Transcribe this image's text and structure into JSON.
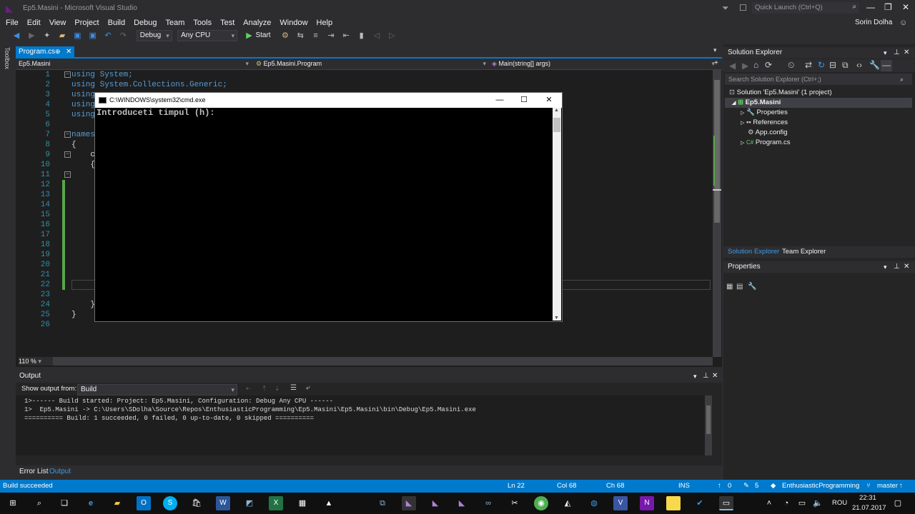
{
  "window": {
    "title": "Ep5.Masini - Microsoft Visual Studio",
    "quick_launch": "Quick Launch (Ctrl+Q)",
    "user": "Sorin Dolha"
  },
  "menu": [
    "File",
    "Edit",
    "View",
    "Project",
    "Build",
    "Debug",
    "Team",
    "Tools",
    "Test",
    "Analyze",
    "Window",
    "Help"
  ],
  "toolbar": {
    "config": "Debug",
    "platform": "Any CPU",
    "start": "Start"
  },
  "side": {
    "toolbox": "Toolbox"
  },
  "editor": {
    "tab": "Program.cs",
    "nav_project": "Ep5.Masini",
    "nav_class": "Ep5.Masini.Program",
    "nav_member": "Main(string[] args)",
    "zoom": "110 %",
    "lines": [
      {
        "n": "1",
        "text": "using System;"
      },
      {
        "n": "2",
        "text": "using System.Collections.Generic;"
      },
      {
        "n": "3",
        "text": "using"
      },
      {
        "n": "4",
        "text": "using"
      },
      {
        "n": "5",
        "text": "using"
      },
      {
        "n": "6",
        "text": ""
      },
      {
        "n": "7",
        "text": "namesp"
      },
      {
        "n": "8",
        "text": "{"
      },
      {
        "n": "9",
        "text": "    cl"
      },
      {
        "n": "10",
        "text": "    {"
      },
      {
        "n": "11",
        "text": ""
      },
      {
        "n": "12",
        "text": ""
      },
      {
        "n": "13",
        "text": ""
      },
      {
        "n": "14",
        "text": ""
      },
      {
        "n": "15",
        "text": ""
      },
      {
        "n": "16",
        "text": ""
      },
      {
        "n": "17",
        "text": ""
      },
      {
        "n": "18",
        "text": ""
      },
      {
        "n": "19",
        "text": ""
      },
      {
        "n": "20",
        "text": ""
      },
      {
        "n": "21",
        "text": ""
      },
      {
        "n": "22",
        "text": ""
      },
      {
        "n": "23",
        "text": ""
      },
      {
        "n": "24",
        "text": "    }"
      },
      {
        "n": "25",
        "text": "}"
      },
      {
        "n": "26",
        "text": ""
      }
    ]
  },
  "console": {
    "title": "C:\\WINDOWS\\system32\\cmd.exe",
    "text": "Introduceti timpul (h):"
  },
  "output": {
    "title": "Output",
    "show_from_label": "Show output from:",
    "source": "Build",
    "lines": [
      "1>------ Build started: Project: Ep5.Masini, Configuration: Debug Any CPU ------",
      "1>  Ep5.Masini -> C:\\Users\\SDolha\\Source\\Repos\\EnthusiasticProgramming\\Ep5.Masini\\Ep5.Masini\\bin\\Debug\\Ep5.Masini.exe",
      "========== Build: 1 succeeded, 0 failed, 0 up-to-date, 0 skipped =========="
    ],
    "tabs": [
      "Error List",
      "Output"
    ]
  },
  "solution_explorer": {
    "title": "Solution Explorer",
    "search": "Search Solution Explorer (Ctrl+;)",
    "items": [
      "Solution 'Ep5.Masini' (1 project)",
      "Ep5.Masini",
      "Properties",
      "References",
      "App.config",
      "Program.cs"
    ],
    "tabs": [
      "Solution Explorer",
      "Team Explorer"
    ]
  },
  "properties": {
    "title": "Properties"
  },
  "status": {
    "message": "Build succeeded",
    "ln": "Ln 22",
    "col": "Col 68",
    "ch": "Ch 68",
    "mode": "INS",
    "up": "0",
    "edits": "5",
    "repo": "EnthusiasticProgramming",
    "branch": "master"
  },
  "taskbar": {
    "language": "ROU",
    "time": "22:31",
    "date": "21.07.2017"
  },
  "colors": {
    "accent": "#007acc",
    "chrome": "#2d2d30",
    "editor_bg": "#1e1e1e",
    "keyword": "#569cd6",
    "line_number": "#2b91af"
  }
}
